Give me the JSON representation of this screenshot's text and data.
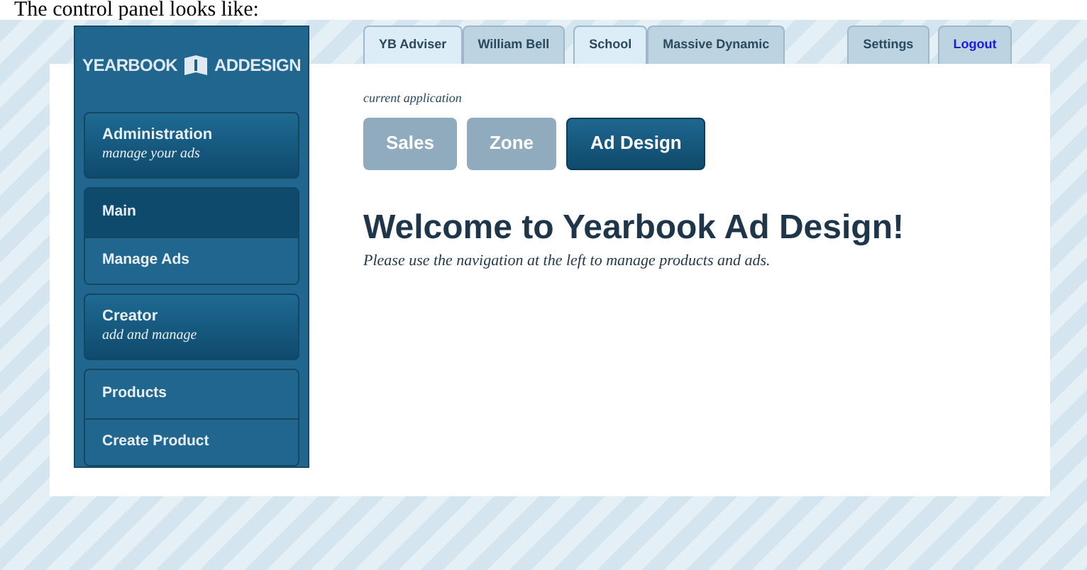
{
  "caption": "The control panel looks like:",
  "logo": {
    "left": "YEARBOOK",
    "right": "ADDESIGN"
  },
  "sidebar": {
    "groups": [
      {
        "kind": "header",
        "title": "Administration",
        "subtitle": "manage your ads"
      },
      {
        "kind": "list",
        "items": [
          {
            "label": "Main",
            "selected": true
          },
          {
            "label": "Manage Ads",
            "selected": false
          }
        ]
      },
      {
        "kind": "header",
        "title": "Creator",
        "subtitle": "add and manage"
      },
      {
        "kind": "list",
        "items": [
          {
            "label": "Products",
            "selected": false
          },
          {
            "label": "Create Product",
            "selected": false
          }
        ]
      }
    ]
  },
  "tab_groups": [
    [
      {
        "label": "YB Adviser",
        "selected": true,
        "kind": "tab"
      },
      {
        "label": "William Bell",
        "selected": false,
        "kind": "tab"
      }
    ],
    [
      {
        "label": "School",
        "selected": true,
        "kind": "tab"
      },
      {
        "label": "Massive Dynamic",
        "selected": false,
        "kind": "tab"
      }
    ],
    [
      {
        "label": "Settings",
        "selected": false,
        "kind": "tab"
      }
    ],
    [
      {
        "label": "Logout",
        "selected": false,
        "kind": "link"
      }
    ]
  ],
  "application": {
    "label": "current application",
    "buttons": [
      {
        "label": "Sales",
        "selected": false
      },
      {
        "label": "Zone",
        "selected": false
      },
      {
        "label": "Ad Design",
        "selected": true
      }
    ]
  },
  "heading": "Welcome to Yearbook Ad Design!",
  "intro": "Please use the navigation at the left to manage products and ads."
}
